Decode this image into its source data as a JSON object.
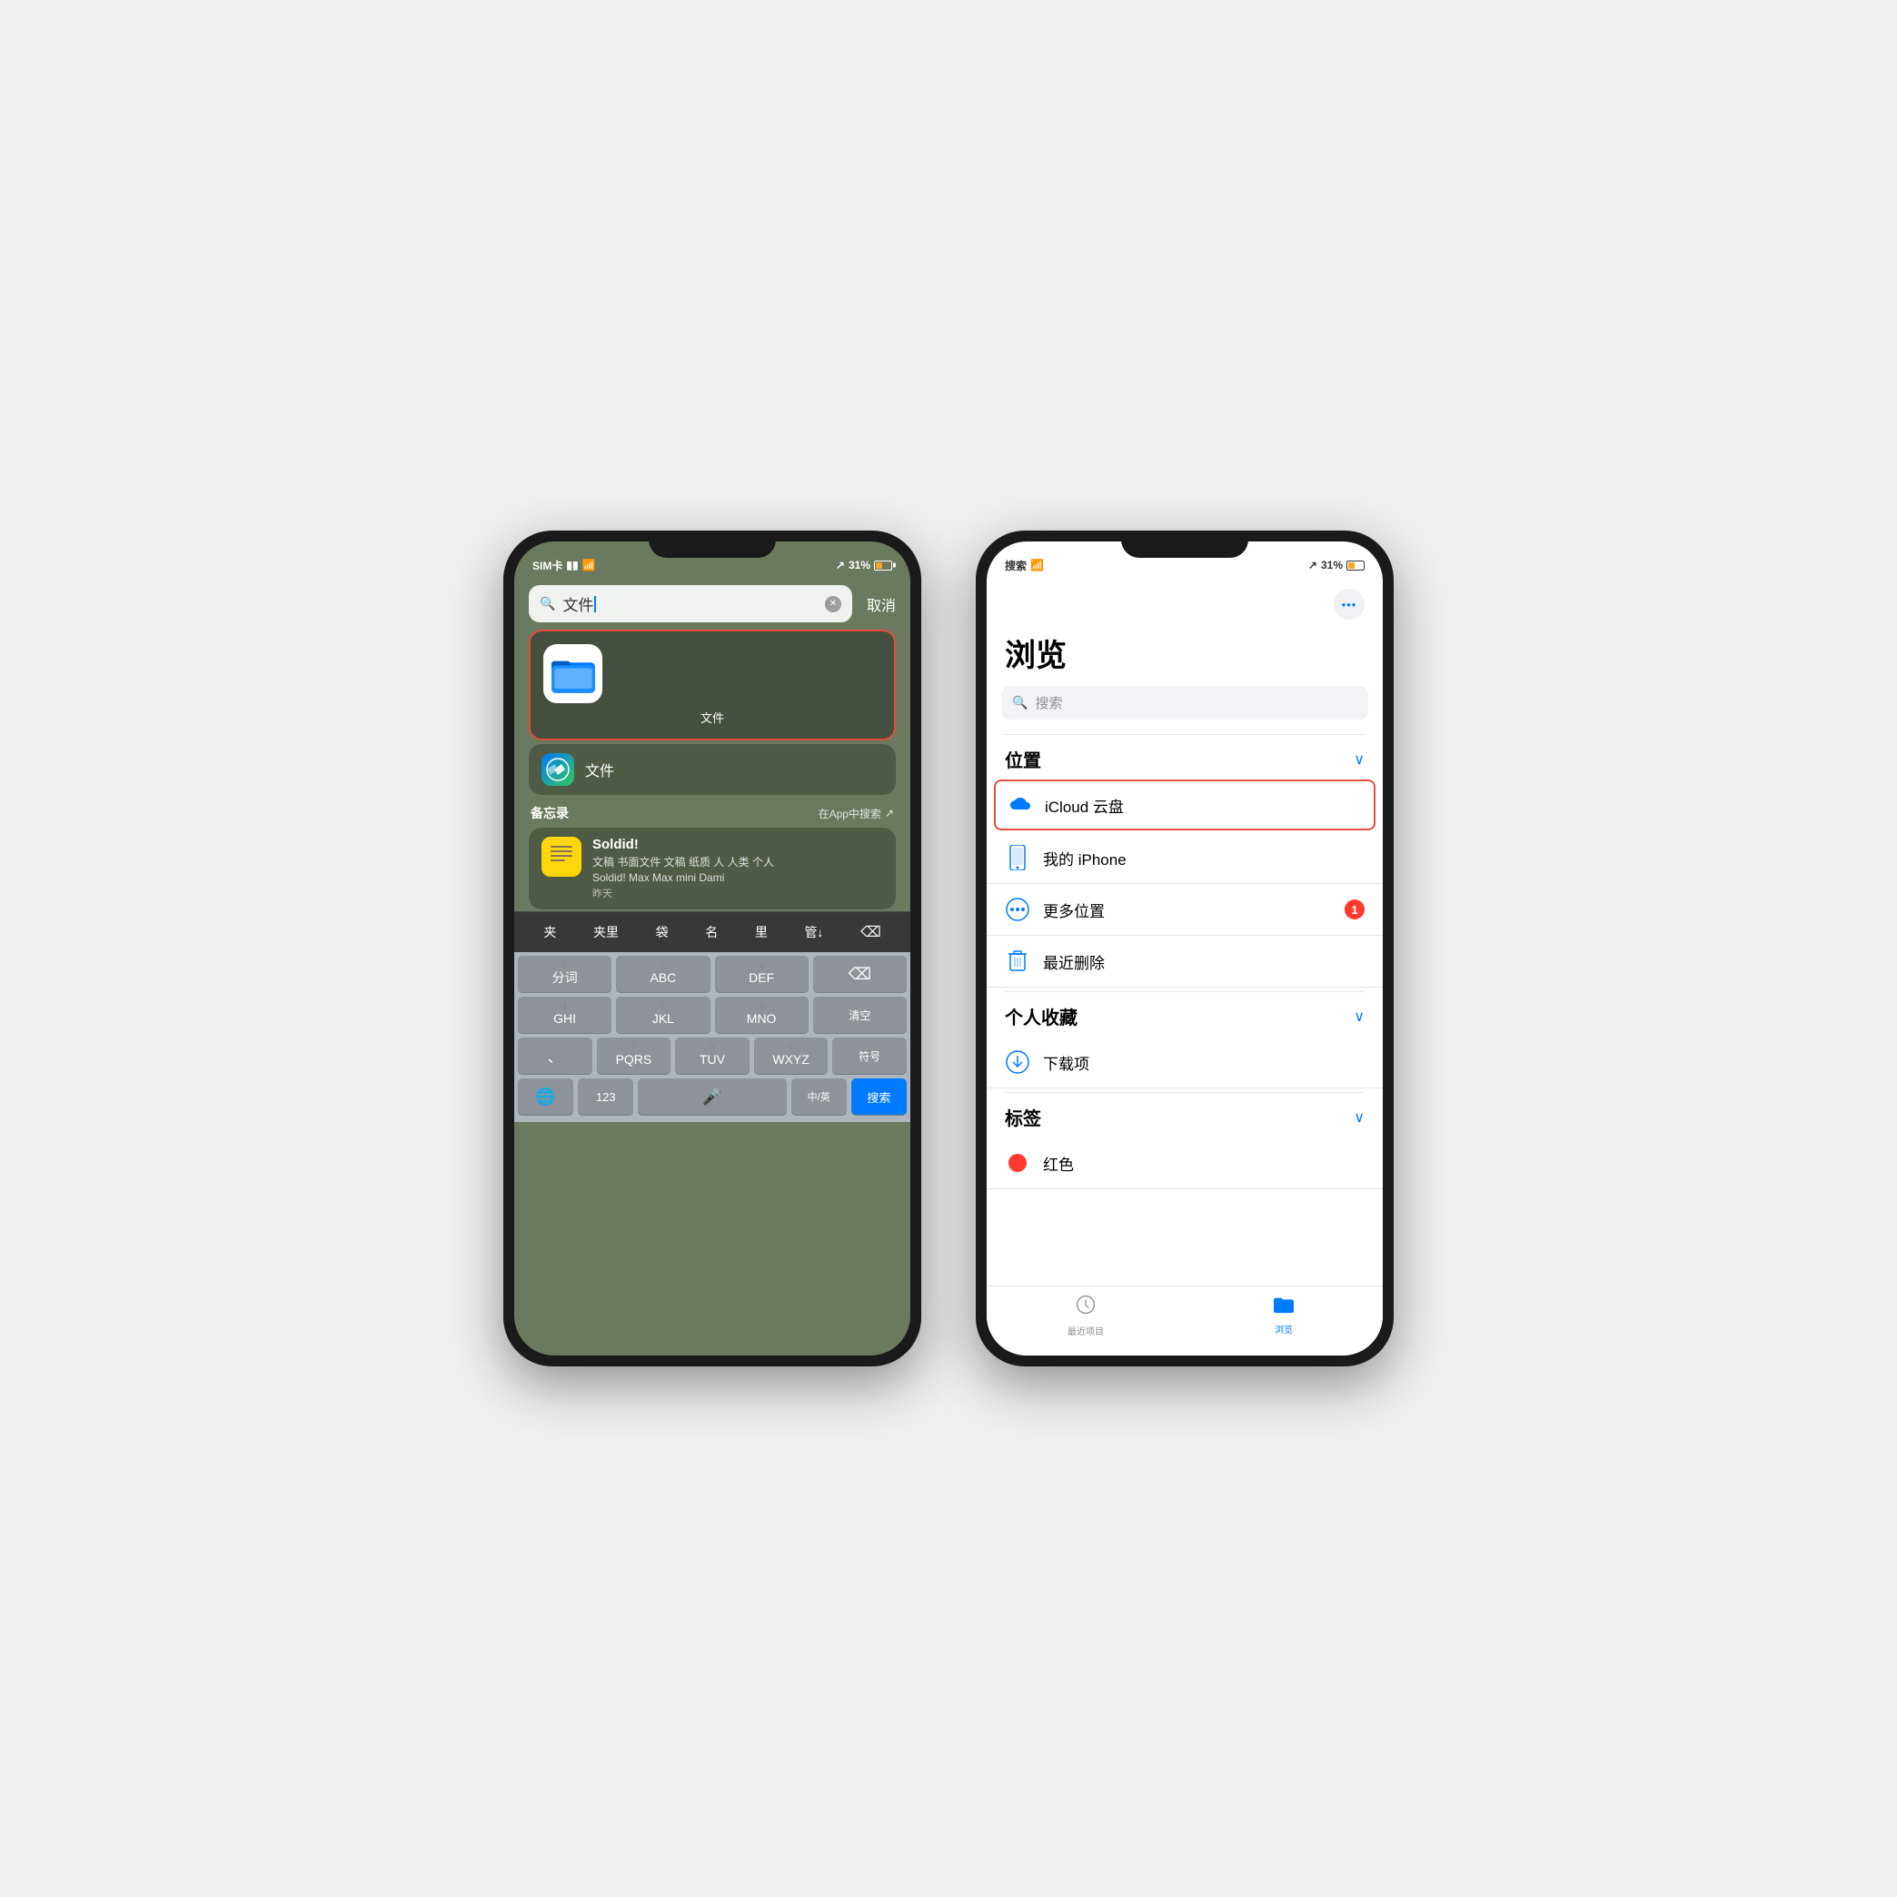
{
  "left_phone": {
    "status": {
      "carrier": "SIM卡",
      "wifi": "wifi",
      "signal_arrow": "↗",
      "battery": "31%",
      "battery_color": "#f5a623"
    },
    "search": {
      "placeholder": "文件",
      "cancel_label": "取消"
    },
    "top_app": {
      "name": "文件",
      "label": "文件"
    },
    "second_app": {
      "icon": "Safari",
      "name": "文件"
    },
    "section": {
      "title": "备忘录",
      "action": "在App中搜索",
      "action_icon": "↗"
    },
    "notes_item": {
      "title": "Soldid!",
      "preview": "文稿 书面文件 文稿 纸质 人 人类 个人",
      "preview2": "Soldid! Max Max mini Dami",
      "date": "昨天"
    },
    "keyboard_suggestions": [
      "夹",
      "夹里",
      "袋",
      "名",
      "里",
      "管↓"
    ],
    "keyboard_rows": [
      [
        "分词\n1",
        "ABC\n2",
        "DEF\n3"
      ],
      [
        "GHI\n4",
        "JKL\n5",
        "MNO\n6",
        "清空"
      ],
      [
        "PQRS\n7",
        "TUV\n8",
        "WXYZ\n9",
        "符号"
      ],
      [
        "🌐",
        "123",
        "mic",
        "中/英",
        "搜索"
      ]
    ]
  },
  "right_phone": {
    "status": {
      "left": "搜索",
      "wifi": "wifi",
      "signal_arrow": "↗",
      "battery": "31%"
    },
    "title": "浏览",
    "search_placeholder": "搜索",
    "more_button": "•••",
    "sections": {
      "locations": {
        "title": "位置",
        "items": [
          {
            "name": "iCloud 云盘",
            "icon": "cloud",
            "highlighted": true
          },
          {
            "name": "我的 iPhone",
            "icon": "iphone"
          },
          {
            "name": "更多位置",
            "icon": "more",
            "badge": "1"
          },
          {
            "name": "最近删除",
            "icon": "trash"
          }
        ]
      },
      "favorites": {
        "title": "个人收藏",
        "items": [
          {
            "name": "下载项",
            "icon": "download"
          }
        ]
      },
      "tags": {
        "title": "标签",
        "items": [
          {
            "name": "红色",
            "icon": "red-dot"
          }
        ]
      }
    },
    "tabs": [
      {
        "label": "最近项目",
        "icon": "clock",
        "active": false
      },
      {
        "label": "浏览",
        "icon": "folder",
        "active": true
      }
    ]
  }
}
